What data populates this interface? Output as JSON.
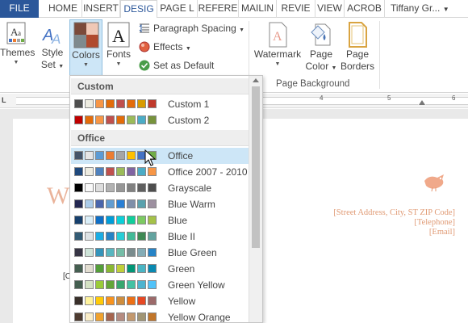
{
  "tabs": [
    {
      "label": "FILE",
      "name": "tab-file"
    },
    {
      "label": "HOME",
      "name": "tab-home"
    },
    {
      "label": "INSERT",
      "name": "tab-insert"
    },
    {
      "label": "DESIG",
      "name": "tab-design"
    },
    {
      "label": "PAGE L",
      "name": "tab-page-layout"
    },
    {
      "label": "REFERE",
      "name": "tab-references"
    },
    {
      "label": "MAILIN",
      "name": "tab-mailings"
    },
    {
      "label": "REVIE",
      "name": "tab-review"
    },
    {
      "label": "VIEW",
      "name": "tab-view"
    },
    {
      "label": "ACROB",
      "name": "tab-acrobat"
    }
  ],
  "user_name": "Tiffany Gr...",
  "ribbon": {
    "themes": "Themes",
    "style_set_1": "Style",
    "style_set_2": "Set",
    "colors": "Colors",
    "fonts": "Fonts",
    "paragraph_spacing": "Paragraph Spacing",
    "effects": "Effects",
    "set_as_default": "Set as Default",
    "watermark": "Watermark",
    "page_color_1": "Page",
    "page_color_2": "Color",
    "page_borders_1": "Page",
    "page_borders_2": "Borders",
    "page_background_group": "Page Background"
  },
  "ruler_numbers": [
    "4",
    "5",
    "6"
  ],
  "dropdown": {
    "custom_header": "Custom",
    "office_header": "Office",
    "custom": [
      {
        "name": "Custom 1",
        "colors": [
          "#4f4f4f",
          "#eeece1",
          "#f79646",
          "#e36c09",
          "#c0504d",
          "#e46c0a",
          "#d99b00",
          "#c0392b"
        ]
      },
      {
        "name": "Custom 2",
        "colors": [
          "#c00000",
          "#e46c0a",
          "#f79646",
          "#c0504d",
          "#e36c09",
          "#9bbb59",
          "#4bacc6",
          "#77933c"
        ]
      }
    ],
    "office": [
      {
        "name": "Office",
        "colors": [
          "#44546a",
          "#e7e6e6",
          "#5b9bd5",
          "#ed7d31",
          "#a5a5a5",
          "#ffc000",
          "#4472c4",
          "#70ad47"
        ]
      },
      {
        "name": "Office 2007 - 2010",
        "colors": [
          "#1f497d",
          "#eeece1",
          "#4f81bd",
          "#c0504d",
          "#9bbb59",
          "#8064a2",
          "#4bacc6",
          "#f79646"
        ]
      },
      {
        "name": "Grayscale",
        "colors": [
          "#000000",
          "#f8f8f8",
          "#dddddd",
          "#b2b2b2",
          "#969696",
          "#808080",
          "#5f5f5f",
          "#4d4d4d"
        ]
      },
      {
        "name": "Blue Warm",
        "colors": [
          "#242852",
          "#acccea",
          "#4a66ac",
          "#629dd1",
          "#297fd5",
          "#7f8fa9",
          "#5aa2ae",
          "#9d90a0"
        ]
      },
      {
        "name": "Blue",
        "colors": [
          "#17406d",
          "#dbeff9",
          "#0f6fc6",
          "#009dd9",
          "#0bd0d9",
          "#10cf9b",
          "#7cca62",
          "#a5c249"
        ]
      },
      {
        "name": "Blue II",
        "colors": [
          "#335b74",
          "#dfe3e5",
          "#1cade4",
          "#2683c6",
          "#27ced7",
          "#42ba97",
          "#3e8853",
          "#62a39f"
        ]
      },
      {
        "name": "Blue Green",
        "colors": [
          "#373545",
          "#cee4d9",
          "#3494ba",
          "#58b6c0",
          "#75bda7",
          "#7a8c8e",
          "#84acb6",
          "#2683c6"
        ]
      },
      {
        "name": "Green",
        "colors": [
          "#455f51",
          "#e3ded1",
          "#549e39",
          "#8ab833",
          "#c0cf3a",
          "#029676",
          "#4ab5c4",
          "#0989b1"
        ]
      },
      {
        "name": "Green Yellow",
        "colors": [
          "#455f51",
          "#d4e2c4",
          "#99cb38",
          "#63a537",
          "#37a76f",
          "#44c1a3",
          "#4eb3cf",
          "#51c3f9"
        ]
      },
      {
        "name": "Yellow",
        "colors": [
          "#39302a",
          "#fff39d",
          "#ffca08",
          "#f8931d",
          "#ce8d3e",
          "#ec7016",
          "#e64823",
          "#9c6a6a"
        ]
      },
      {
        "name": "Yellow Orange",
        "colors": [
          "#4e3b30",
          "#fbeec9",
          "#f0a22e",
          "#a5644e",
          "#b58b80",
          "#c3986d",
          "#a19574",
          "#c17529"
        ]
      }
    ]
  },
  "document": {
    "address": "[Street Address, City, ST ZIP Code]",
    "telephone": "[Telephone]",
    "email": "[Email]",
    "heading_fragment": "W",
    "text_fragment": "[C"
  },
  "colors": {
    "file_tab": "#2b579a",
    "selection": "#cde6f7",
    "accent_text": "#e09a74"
  }
}
